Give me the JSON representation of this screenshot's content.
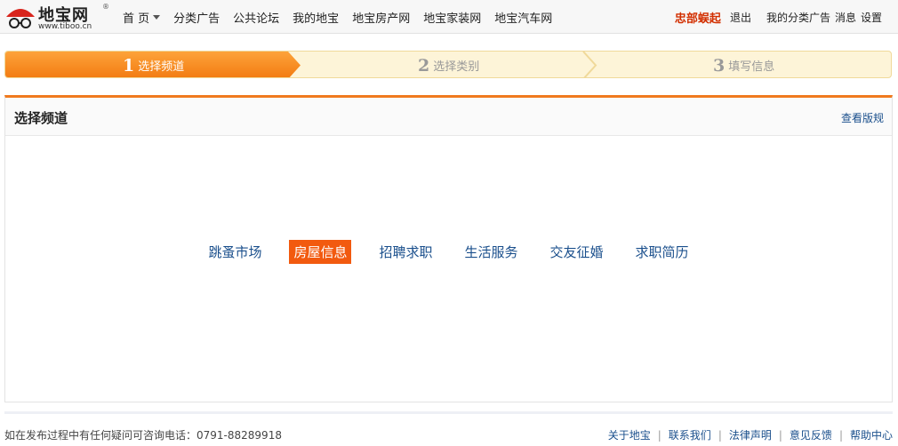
{
  "logo": {
    "text": "地宝网",
    "reg": "®",
    "url": "www.tiboo.cn"
  },
  "nav": {
    "items": [
      {
        "label": "首 页"
      },
      {
        "label": "分类广告"
      },
      {
        "label": "公共论坛"
      },
      {
        "label": "我的地宝"
      },
      {
        "label": "地宝房产网"
      },
      {
        "label": "地宝家装网"
      },
      {
        "label": "地宝汽车网"
      }
    ]
  },
  "user": {
    "name": "忠部蜈起",
    "logout": "退出",
    "my_ads": "我的分类广告",
    "messages": "消息",
    "settings": "设置"
  },
  "steps": [
    {
      "num": "1",
      "label": "选择频道",
      "active": true
    },
    {
      "num": "2",
      "label": "选择类别",
      "active": false
    },
    {
      "num": "3",
      "label": "填写信息",
      "active": false
    }
  ],
  "panel": {
    "title": "选择频道",
    "link": "查看版规"
  },
  "channels": [
    {
      "label": "跳蚤市场",
      "selected": false
    },
    {
      "label": "房屋信息",
      "selected": true
    },
    {
      "label": "招聘求职",
      "selected": false
    },
    {
      "label": "生活服务",
      "selected": false
    },
    {
      "label": "交友征婚",
      "selected": false
    },
    {
      "label": "求职简历",
      "selected": false
    }
  ],
  "footer": {
    "hotline_label": "如在发布过程中有任何疑问可咨询电话：",
    "hotline_number": "0791-88289918",
    "links": [
      "关于地宝",
      "联系我们",
      "法律声明",
      "意见反馈",
      "帮助中心"
    ],
    "separator": "|"
  },
  "colors": {
    "accent_orange": "#f07a1e",
    "selected_channel": "#f25a0f",
    "link_blue": "#1a4f8c",
    "username_red": "#d22f00"
  }
}
